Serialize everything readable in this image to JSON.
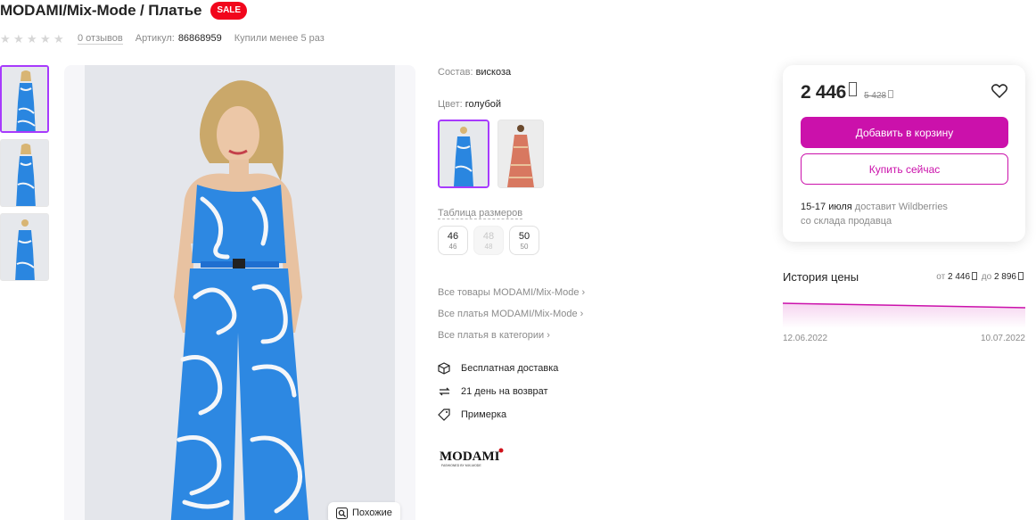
{
  "product": {
    "title": "MODAMI/Mix-Mode / Платье",
    "sale_badge": "SALE",
    "reviews": "0 отзывов",
    "article_label": "Артикул:",
    "article_value": "86868959",
    "bought": "Купили менее 5 раз",
    "rating_stars": 0
  },
  "gallery": {
    "similar_label": "Похожие"
  },
  "details": {
    "composition_label": "Состав:",
    "composition_value": "вискоза",
    "color_label": "Цвет:",
    "color_value": "голубой",
    "size_table_label": "Таблица размеров",
    "sizes": [
      {
        "size": "46",
        "ru": "46",
        "available": true
      },
      {
        "size": "48",
        "ru": "48",
        "available": false
      },
      {
        "size": "50",
        "ru": "50",
        "available": true
      }
    ],
    "links": [
      "Все товары MODAMI/Mix-Mode",
      "Все платья MODAMI/Mix-Mode",
      "Все платья в категории"
    ],
    "features": [
      {
        "icon": "box-icon",
        "label": "Бесплатная доставка"
      },
      {
        "icon": "return-arrows-icon",
        "label": "21 день на возврат"
      },
      {
        "icon": "tag-icon",
        "label": "Примерка"
      }
    ],
    "brand_logo_text": "MODAMI",
    "brand_logo_subtext": "FASHIONED BY MIX-MODE"
  },
  "purchase": {
    "price": "2 446",
    "old_price": "5 428",
    "add_to_cart": "Добавить в корзину",
    "buy_now": "Купить сейчас",
    "delivery_dates": "15-17 июля",
    "delivery_text": " доставит Wildberries",
    "delivery_from": "со склада продавца"
  },
  "price_history": {
    "title": "История цены",
    "range_from_label": "от ",
    "range_from": "2 446",
    "range_to_label": " до ",
    "range_to": "2 896",
    "date_start": "12.06.2022",
    "date_end": "10.07.2022"
  },
  "colors": {
    "accent": "#cb11ab",
    "sale": "#f1061c",
    "selected_border": "#a73afd",
    "dress_blue": "#1f7fe0"
  }
}
